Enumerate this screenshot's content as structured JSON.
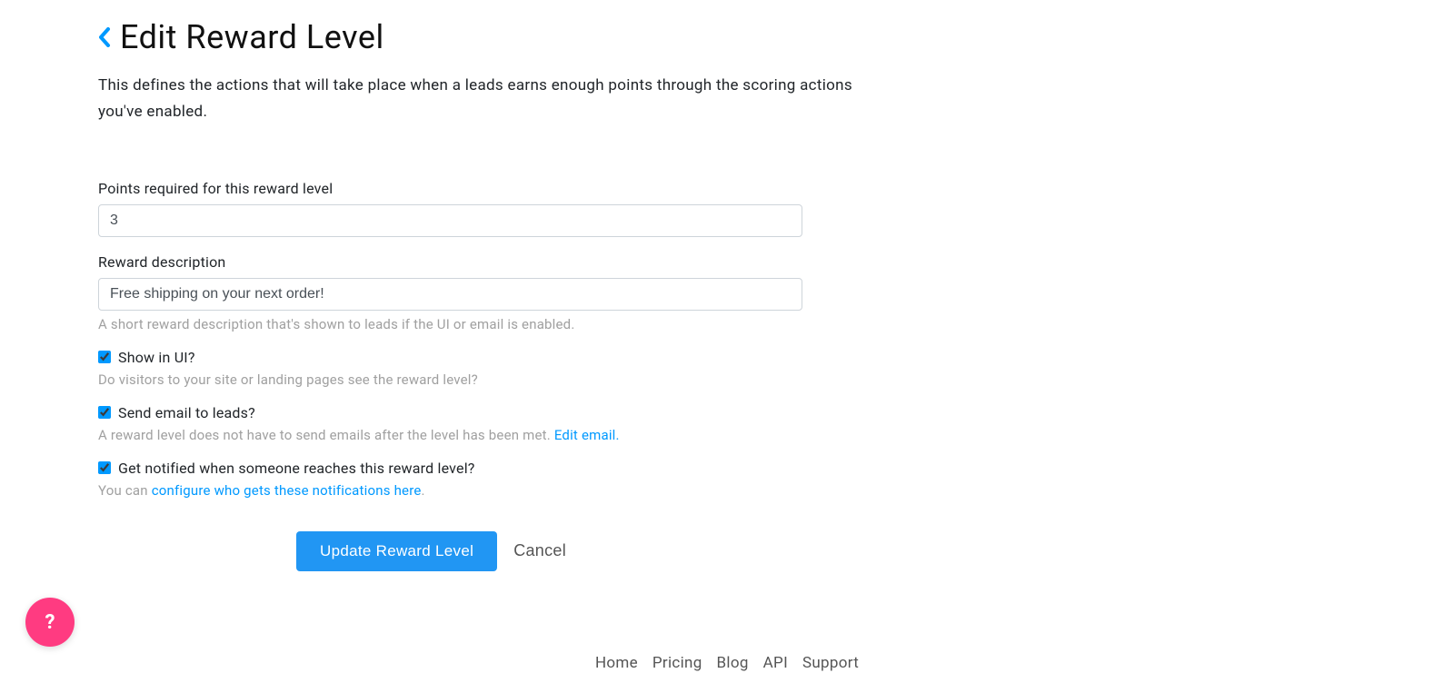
{
  "header": {
    "title": "Edit Reward Level",
    "subtitle": "This defines the actions that will take place when a leads earns enough points through the scoring actions you've enabled."
  },
  "form": {
    "points": {
      "label": "Points required for this reward level",
      "value": "3"
    },
    "description": {
      "label": "Reward description",
      "value": "Free shipping on your next order!",
      "help": "A short reward description that's shown to leads if the UI or email is enabled."
    },
    "show_in_ui": {
      "label": "Show in UI?",
      "help": "Do visitors to your site or landing pages see the reward level?",
      "checked": true
    },
    "send_email": {
      "label": "Send email to leads?",
      "help_prefix": "A reward level does not have to send emails after the level has been met. ",
      "help_link": "Edit email.",
      "checked": true
    },
    "get_notified": {
      "label": "Get notified when someone reaches this reward level?",
      "help_prefix": "You can ",
      "help_link": "configure who gets these notifications here",
      "help_suffix": ".",
      "checked": true
    },
    "submit_label": "Update Reward Level",
    "cancel_label": "Cancel"
  },
  "footer": {
    "links": [
      "Home",
      "Pricing",
      "Blog",
      "API",
      "Support"
    ]
  },
  "help_bubble": "?"
}
